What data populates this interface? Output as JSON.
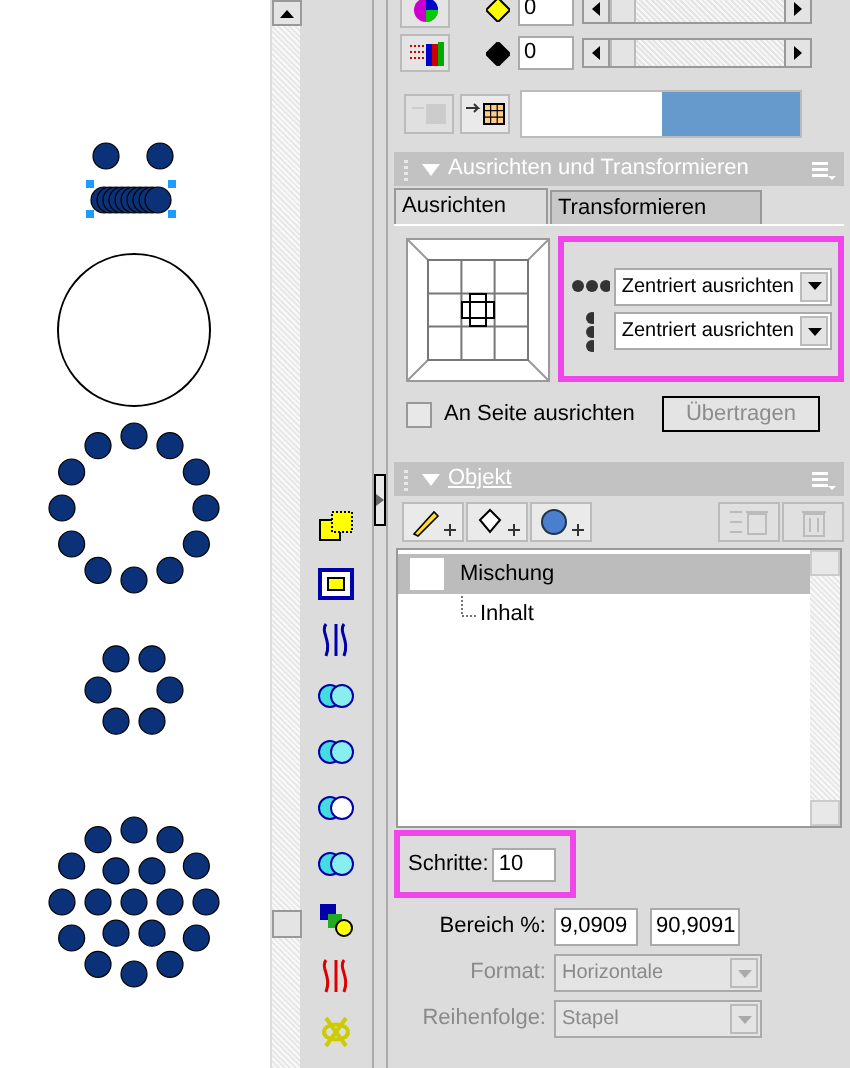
{
  "fill_rows": [
    {
      "value": "0",
      "level": 0
    },
    {
      "value": "0",
      "level": 0
    }
  ],
  "align_panel": {
    "title": "Ausrichten und Transformieren",
    "tabs": [
      {
        "label": "Ausrichten",
        "selected": true
      },
      {
        "label": "Transformieren",
        "selected": false
      }
    ],
    "horizontal": "Zentriert ausrichten",
    "vertical": "Zentriert ausrichten",
    "page_checkbox": {
      "label": "An Seite ausrichten",
      "checked": false
    },
    "apply_button": {
      "label": "Übertragen",
      "disabled": true
    }
  },
  "object_panel": {
    "title": "Objekt",
    "tree": [
      {
        "label": "Mischung",
        "selected": true,
        "children": [
          {
            "label": "Inhalt",
            "selected": false
          }
        ]
      }
    ],
    "steps": {
      "label": "Schritte:",
      "value": "10"
    },
    "range": {
      "label": "Bereich %:",
      "from": "9,0909",
      "to": "90,9091"
    },
    "format": {
      "label": "Format:",
      "value": "Horizontale",
      "disabled": true
    },
    "order": {
      "label": "Reihenfolge:",
      "value": "Stapel",
      "disabled": true
    }
  }
}
